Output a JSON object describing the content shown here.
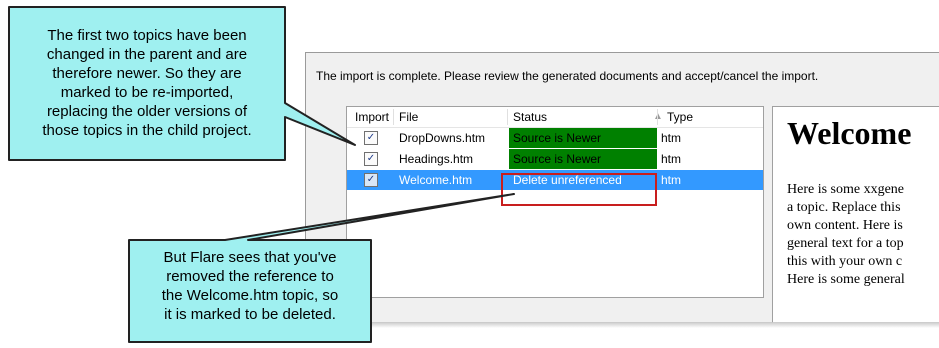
{
  "dialog": {
    "message": "The import is complete. Please review the generated documents and accept/cancel the import."
  },
  "table": {
    "headers": [
      "Import",
      "File",
      "Status",
      "Type"
    ],
    "rows": [
      {
        "checked": "✓",
        "file": "DropDowns.htm",
        "status": "Source is Newer",
        "type": "htm"
      },
      {
        "checked": "✓",
        "file": "Headings.htm",
        "status": "Source is Newer",
        "type": "htm"
      },
      {
        "checked": "✓",
        "file": "Welcome.htm",
        "status": "Delete unreferenced",
        "type": "htm"
      }
    ]
  },
  "preview": {
    "heading": "Welcome",
    "lines": [
      "Here is some xxgene",
      "a topic. Replace this",
      "own content. Here is",
      "general text for a top",
      "this with your own c",
      "Here is some general"
    ]
  },
  "callouts": {
    "top": [
      "The first two topics have been",
      "changed in the parent and are",
      "therefore newer. So they are",
      "marked to be re-imported,",
      "replacing the older versions of",
      "those topics in the child project."
    ],
    "bottom": [
      "But Flare sees that you've",
      "removed the reference to",
      "the Welcome.htm topic, so",
      "it is marked to be deleted."
    ]
  },
  "colors": {
    "callout_fill": "#9ff0f0",
    "status_newer": "#008000",
    "selection": "#3399ff",
    "highlight": "#c81e1e"
  }
}
